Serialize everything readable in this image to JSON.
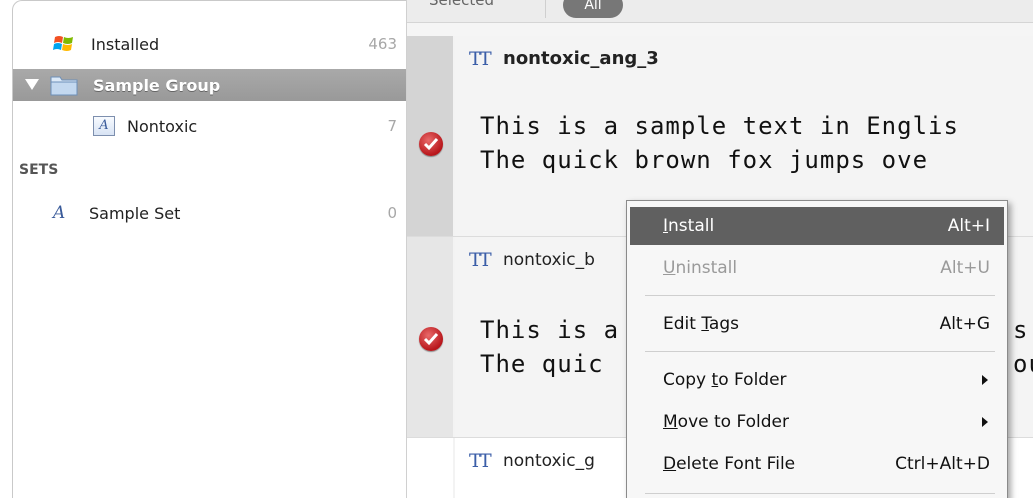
{
  "sidebar": {
    "installed": {
      "label": "Installed",
      "count": "463"
    },
    "group": {
      "label": "Sample Group"
    },
    "nontoxic": {
      "label": "Nontoxic",
      "count": "7"
    },
    "sets_header": "SETS",
    "sample_set": {
      "label": "Sample Set",
      "count": "0"
    },
    "font_icon_glyph": "A",
    "set_icon_glyph": "A"
  },
  "filterbar": {
    "selected": "Selected",
    "all": "All"
  },
  "cards": [
    {
      "name": "nontoxic_ang_3",
      "line1": "This is a sample text in Englis",
      "line2": "The quick brown fox jumps ove"
    },
    {
      "name": "nontoxic_b",
      "line1": "This is a",
      "line1_tail": "s",
      "line2": "The quic",
      "line2_tail": "ou"
    },
    {
      "name": "nontoxic_g"
    }
  ],
  "tt_glyph": "TT",
  "menu": {
    "install": {
      "label": "Install",
      "shortcut": "Alt+I",
      "underline": "I",
      "rest": "nstall"
    },
    "uninstall": {
      "label": "Uninstall",
      "shortcut": "Alt+U",
      "underline": "U",
      "rest": "ninstall"
    },
    "edit_tags": {
      "pre": "Edit ",
      "underline": "T",
      "rest": "ags",
      "shortcut": "Alt+G"
    },
    "copy_to_folder": {
      "pre": "Copy ",
      "underline": "t",
      "rest": "o Folder"
    },
    "move_to_folder": {
      "underline": "M",
      "rest": "ove to Folder"
    },
    "delete_font_file": {
      "underline": "D",
      "rest": "elete Font File",
      "shortcut": "Ctrl+Alt+D"
    }
  },
  "colors": {
    "menu_highlight": "#606060",
    "check_red": "#b8161b",
    "icon_blue": "#3b5ea8"
  }
}
